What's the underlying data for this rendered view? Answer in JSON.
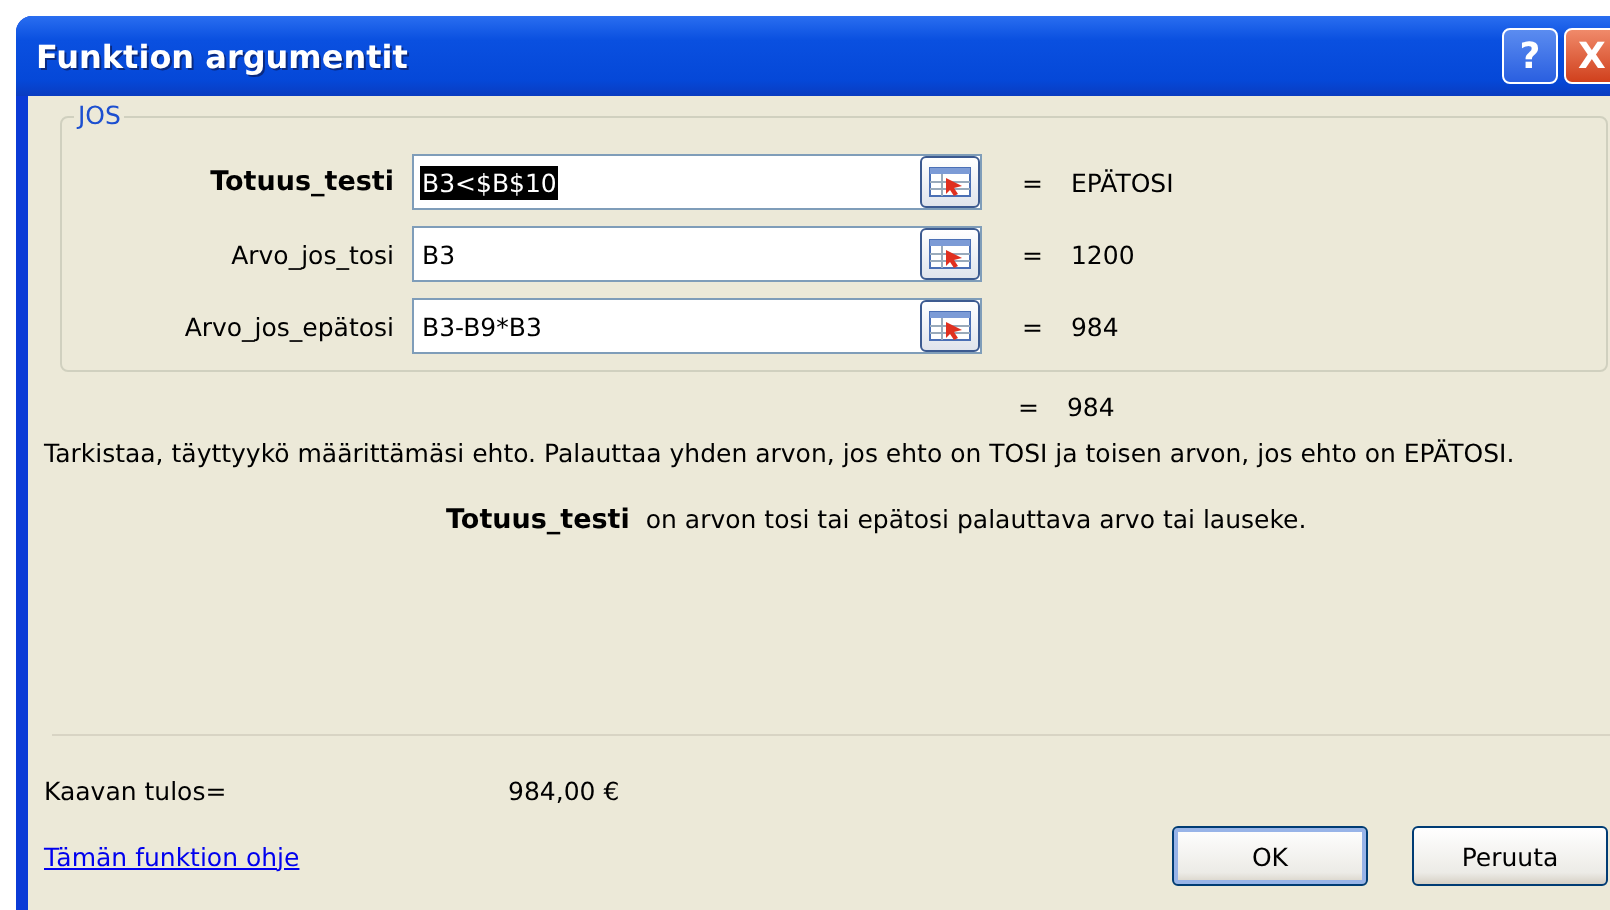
{
  "window": {
    "title": "Funktion argumentit"
  },
  "title_buttons": [
    {
      "kind": "help",
      "label": "?"
    },
    {
      "kind": "close",
      "label": "X"
    }
  ],
  "group": {
    "legend": "JOS",
    "arguments": [
      {
        "label": "Totuus_testi",
        "value": "B3<$B$10",
        "result": "EPÄTOSI",
        "selected": true
      },
      {
        "label": "Arvo_jos_tosi",
        "value": "B3",
        "result": "1200",
        "selected": false
      },
      {
        "label": "Arvo_jos_epätosi",
        "value": "B3-B9*B3",
        "result": "984",
        "selected": false
      }
    ]
  },
  "equals_sign": "=",
  "function_result": "984",
  "description": "Tarkistaa, täyttyykö määrittämäsi ehto. Palauttaa yhden arvon, jos ehto on TOSI ja toisen arvon, jos ehto on EPÄTOSI.",
  "argument_help": {
    "name": "Totuus_testi",
    "text": "on arvon tosi tai epätosi palauttava arvo tai lauseke."
  },
  "formula_result": {
    "label": "Kaavan tulos=",
    "value": "984,00 €"
  },
  "help_link": "Tämän funktion ohje",
  "buttons": [
    {
      "label": "OK",
      "default": true
    },
    {
      "label": "Peruuta",
      "default": false
    }
  ]
}
